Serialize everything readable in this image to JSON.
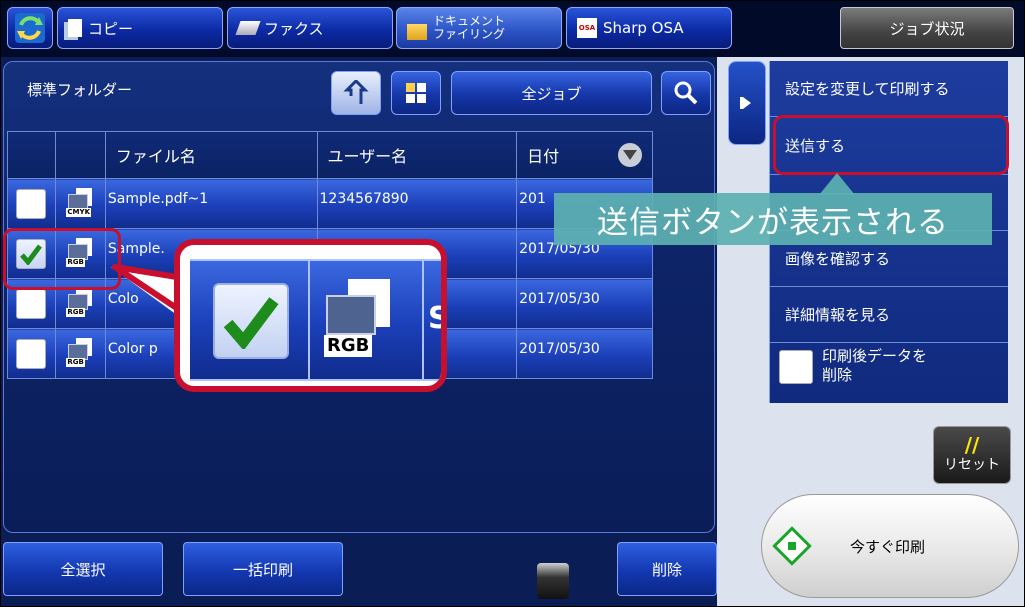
{
  "tabs": {
    "copy": "コピー",
    "fax": "ファクス",
    "doc_line1": "ドキュメント",
    "doc_line2": "ファイリング",
    "osa": "Sharp OSA",
    "osa_badge": "OSA",
    "job_status": "ジョブ状況"
  },
  "folder": {
    "title": "標準フォルダー",
    "filter": "全ジョブ"
  },
  "table": {
    "headers": {
      "filename": "ファイル名",
      "user": "ユーザー名",
      "date": "日付"
    },
    "rows": [
      {
        "checked": false,
        "icon_label": "CMYK",
        "filename": "Sample.pdf~1",
        "user": "1234567890",
        "date": "201"
      },
      {
        "checked": true,
        "icon_label": "RGB",
        "filename": "Sample.",
        "user": "",
        "date": "2017/05/30"
      },
      {
        "checked": false,
        "icon_label": "RGB",
        "filename": "Colo",
        "user": "",
        "date": "2017/05/30"
      },
      {
        "checked": false,
        "icon_label": "RGB",
        "filename": "Color p",
        "user": "",
        "date": "2017/05/30"
      }
    ]
  },
  "bottom": {
    "select_all": "全選択",
    "batch_print": "一括印刷",
    "delete": "削除"
  },
  "menu": {
    "items": [
      "設定を変更して印刷する",
      "送信する",
      "",
      "画像を確認する",
      "詳細情報を見る"
    ],
    "delete_after_line1": "印刷後データを",
    "delete_after_line2": "削除"
  },
  "reset": {
    "slash": "//",
    "label": "リセット"
  },
  "print_now": "今すぐ印刷",
  "zoom": {
    "icon_label": "RGB",
    "partial": "S"
  },
  "annotation": "送信ボタンが表示される",
  "colors": {
    "accent_red": "#c8102e",
    "annotation_bg": "#5cb0b0",
    "start_green": "#1aa52a"
  }
}
